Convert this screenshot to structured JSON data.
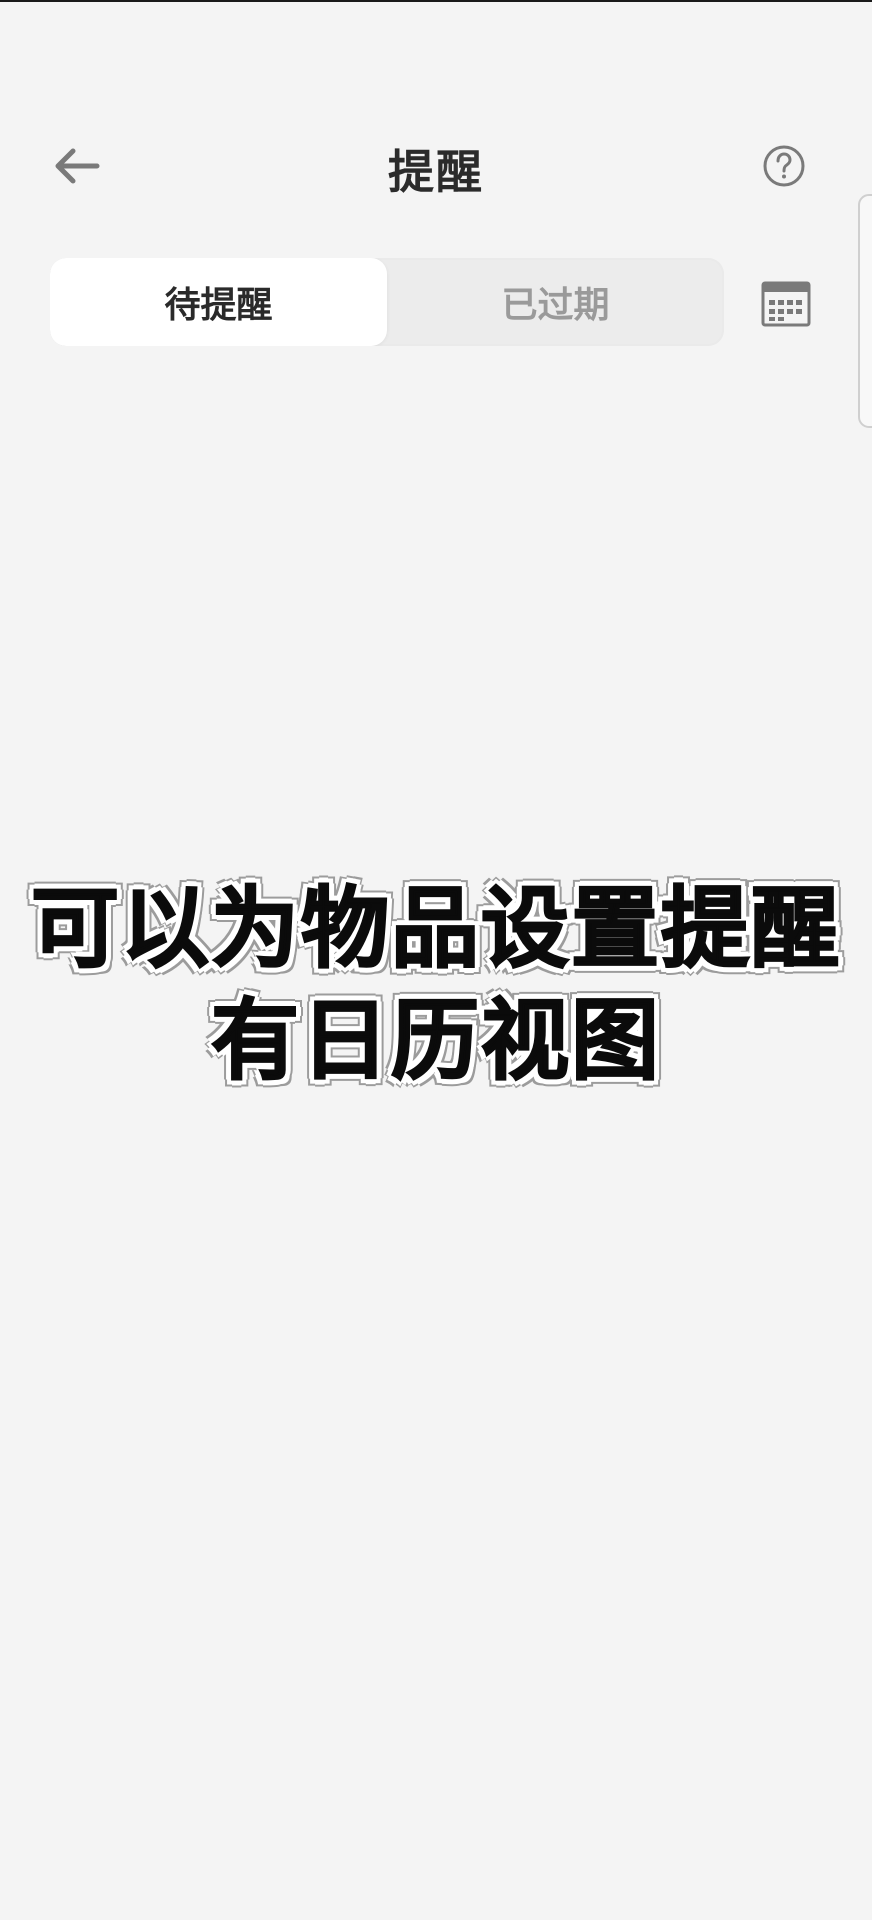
{
  "header": {
    "title": "提醒",
    "back_icon": "arrow-left-icon",
    "help_icon": "question-circle-icon"
  },
  "tabs": [
    {
      "label": "待提醒",
      "active": true
    },
    {
      "label": "已过期",
      "active": false
    }
  ],
  "calendar_icon": "calendar-icon",
  "caption": {
    "line1": "可以为物品设置提醒",
    "line2": "有日历视图"
  },
  "colors": {
    "background": "#f4f4f4",
    "title": "#2b2b2b",
    "tab_active_text": "#2a2a2a",
    "tab_inactive_text": "#9a9a9a",
    "icon": "#7a7a7a"
  }
}
